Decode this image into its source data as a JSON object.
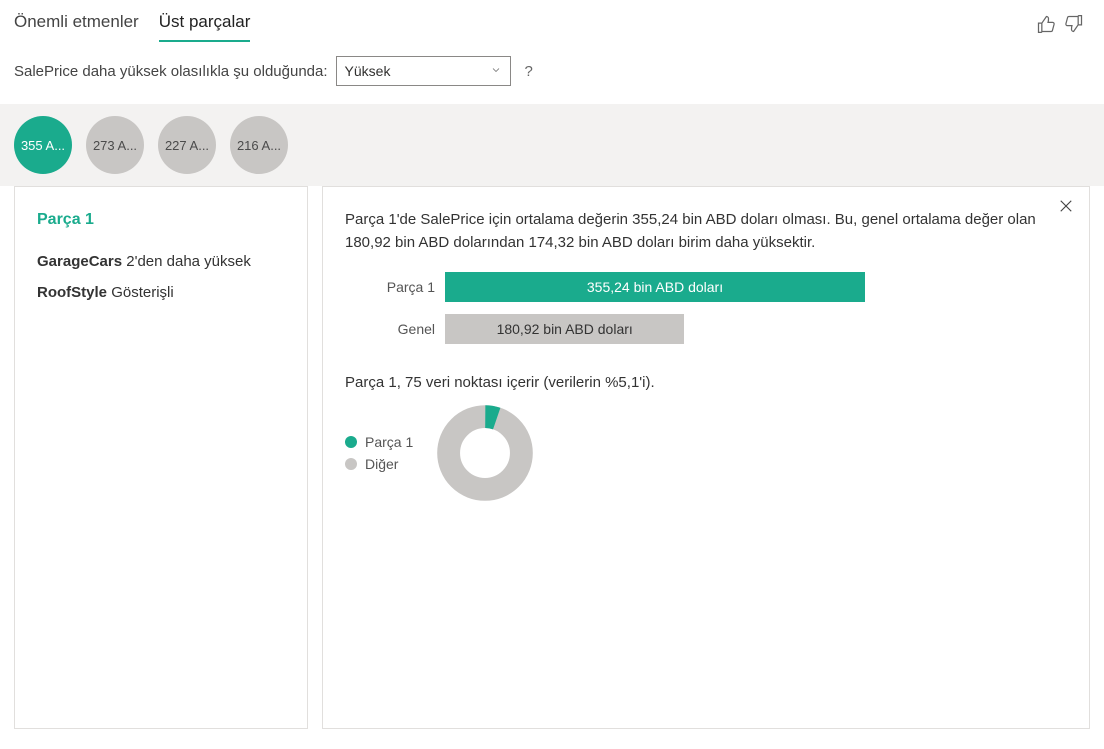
{
  "header": {
    "tabs": [
      {
        "label": "Önemli etmenler"
      },
      {
        "label": "Üst parçalar"
      }
    ]
  },
  "filter": {
    "prompt": "SalePrice daha yüksek olasılıkla şu olduğunda:",
    "selected": "Yüksek",
    "help": "?"
  },
  "chips": [
    {
      "label": "355 A..."
    },
    {
      "label": "273 A..."
    },
    {
      "label": "227 A..."
    },
    {
      "label": "216 A..."
    }
  ],
  "left": {
    "title": "Parça 1",
    "conditions": [
      {
        "field": "GarageCars",
        "desc": "2'den daha yüksek"
      },
      {
        "field": "RoofStyle",
        "desc": "Gösterişli"
      }
    ]
  },
  "right": {
    "summary": "Parça 1'de SalePrice için ortalama değerin 355,24 bin ABD doları olması. Bu, genel ortalama değer olan 180,92 bin ABD dolarından 174,32 bin ABD doları birim daha yüksektir.",
    "bars": {
      "segment_label": "Parça 1",
      "overall_label": "Genel",
      "segment_value_text": "355,24 bin ABD doları",
      "overall_value_text": "180,92 bin ABD doları"
    },
    "donut_caption": "Parça 1, 75 veri noktası içerir (verilerin %5,1'i).",
    "legend": {
      "segment": "Parça 1",
      "other": "Diğer"
    }
  },
  "chart_data": [
    {
      "type": "bar",
      "title": "Segment vs overall average SalePrice (bin ABD doları)",
      "categories": [
        "Parça 1",
        "Genel"
      ],
      "values": [
        355.24,
        180.92
      ],
      "ylabel": "bin ABD doları",
      "ylim": [
        0,
        400
      ]
    },
    {
      "type": "pie",
      "title": "Parça 1 veri noktası oranı",
      "series": [
        {
          "name": "Parça 1",
          "value": 5.1
        },
        {
          "name": "Diğer",
          "value": 94.9
        }
      ]
    }
  ],
  "colors": {
    "accent": "#1aab8d",
    "muted": "#c8c6c4"
  }
}
